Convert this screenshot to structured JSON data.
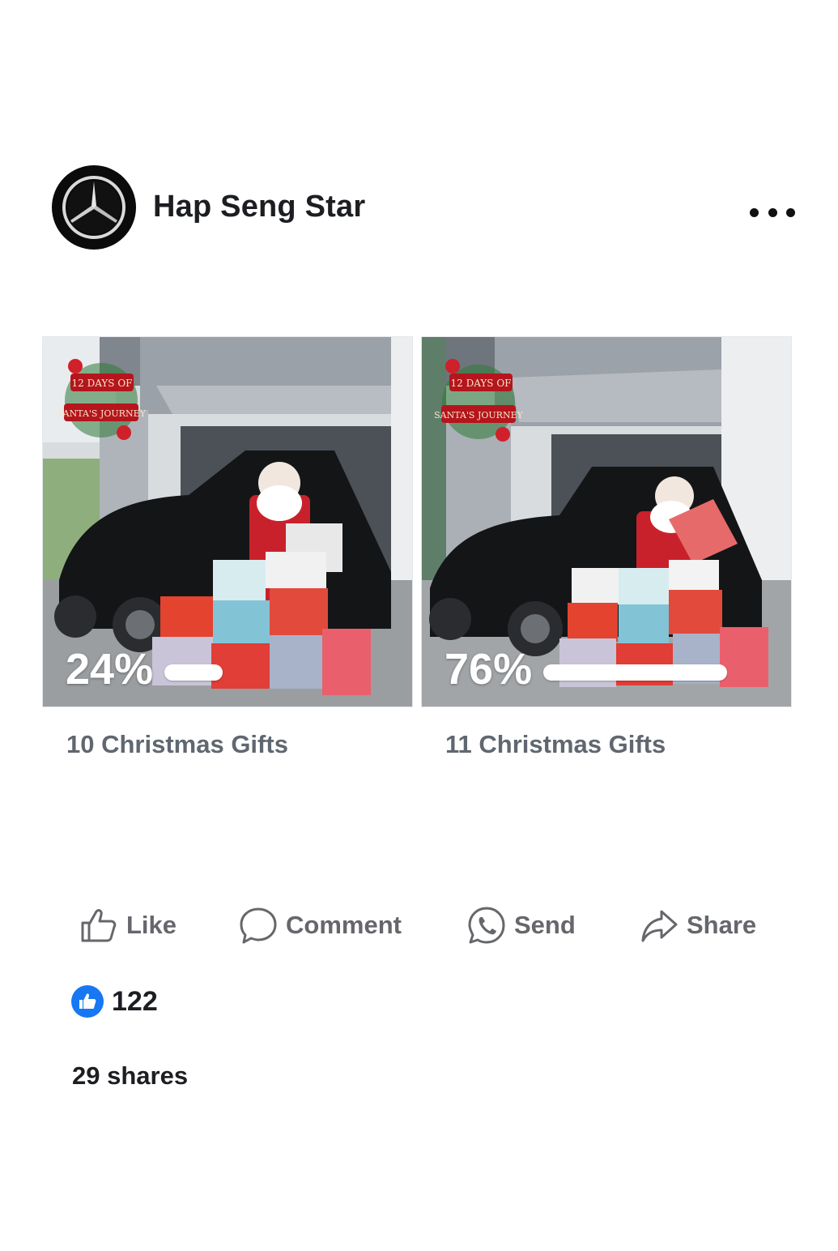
{
  "post": {
    "page_name": "Hap Seng Star",
    "avatar_icon": "mercedes-star-logo",
    "more_icon": "more-horizontal-icon"
  },
  "poll": {
    "options": [
      {
        "percent_label": "24%",
        "percent_value": 24,
        "label": "10 Christmas Gifts",
        "image_badge_text": [
          "12 DAYS OF",
          "SANTA'S JOURNEY"
        ]
      },
      {
        "percent_label": "76%",
        "percent_value": 76,
        "label": "11 Christmas Gifts",
        "image_badge_text": [
          "12 DAYS OF",
          "SANTA'S JOURNEY"
        ]
      }
    ]
  },
  "actions": {
    "like": {
      "label": "Like",
      "icon": "thumbs-up-icon"
    },
    "comment": {
      "label": "Comment",
      "icon": "comment-bubble-icon"
    },
    "send": {
      "label": "Send",
      "icon": "whatsapp-icon"
    },
    "share": {
      "label": "Share",
      "icon": "share-arrow-icon"
    }
  },
  "engagement": {
    "reaction_icon": "like-reaction-icon",
    "reaction_count": "122",
    "shares": "29 shares"
  },
  "colors": {
    "accent": "#1877f2",
    "muted_text": "#65676b",
    "primary_text": "#1c1e21"
  }
}
